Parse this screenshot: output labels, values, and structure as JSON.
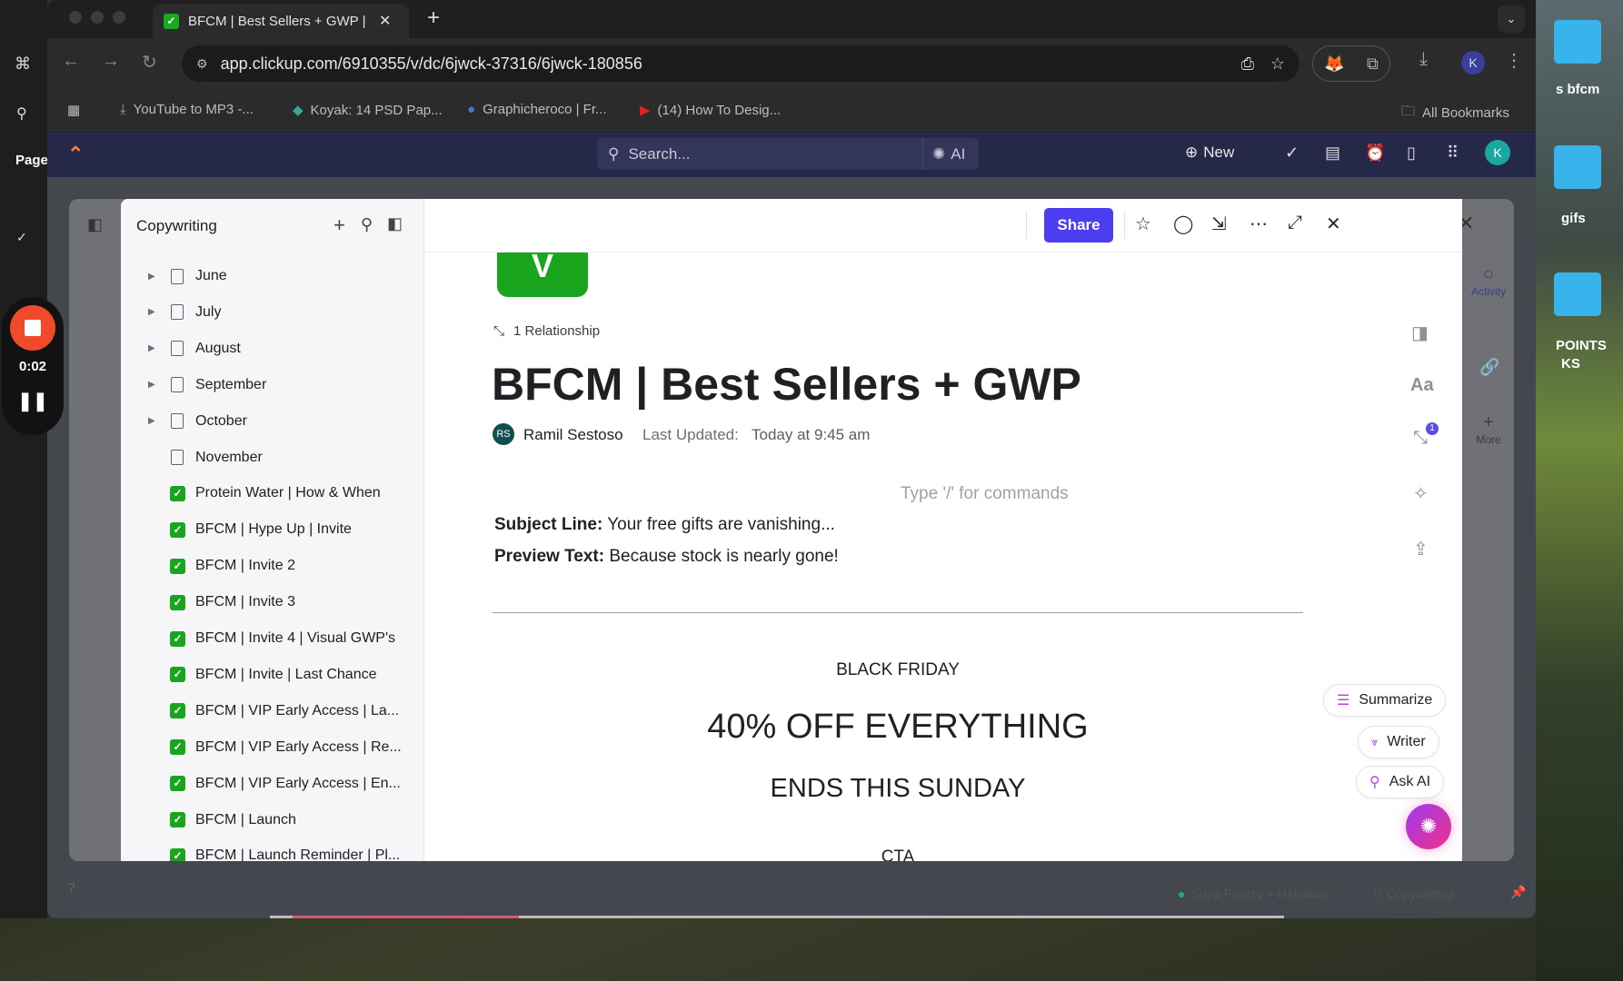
{
  "desktop": {
    "labels": [
      "s bfcm",
      "gifs",
      "POINTS",
      "KS"
    ]
  },
  "recorder": {
    "time": "0:02"
  },
  "figma_strip": {
    "page_label": "Page"
  },
  "browser": {
    "tab_title": "BFCM | Best Sellers + GWP | C",
    "url": "app.clickup.com/6910355/v/dc/6jwck-37316/6jwck-180856",
    "profile_initial": "K",
    "bookmarks": [
      "YouTube to MP3 -...",
      "Koyak: 14 PSD Pap...",
      "Graphicheroco | Fr...",
      "(14) How To Desig..."
    ],
    "all_bookmarks": "All Bookmarks"
  },
  "clickup_top": {
    "search_placeholder": "Search...",
    "ai_label": "AI",
    "new_label": "New",
    "avatar_initial": "K"
  },
  "sidebar": {
    "title": "Copywriting",
    "items": [
      {
        "label": "June",
        "type": "folder"
      },
      {
        "label": "July",
        "type": "folder"
      },
      {
        "label": "August",
        "type": "folder"
      },
      {
        "label": "September",
        "type": "folder"
      },
      {
        "label": "October",
        "type": "folder"
      },
      {
        "label": "November",
        "type": "doc"
      },
      {
        "label": "Protein Water | How & When",
        "type": "done"
      },
      {
        "label": "BFCM | Hype Up | Invite",
        "type": "done"
      },
      {
        "label": "BFCM | Invite 2",
        "type": "done"
      },
      {
        "label": "BFCM | Invite 3",
        "type": "done"
      },
      {
        "label": "BFCM | Invite 4 | Visual GWP's",
        "type": "done"
      },
      {
        "label": "BFCM | Invite | Last Chance",
        "type": "done"
      },
      {
        "label": "BFCM | VIP Early Access | La...",
        "type": "done"
      },
      {
        "label": "BFCM | VIP Early Access | Re...",
        "type": "done"
      },
      {
        "label": "BFCM | VIP Early Access | En...",
        "type": "done"
      },
      {
        "label": "BFCM | Launch",
        "type": "done"
      },
      {
        "label": "BFCM | Launch Reminder | Pl...",
        "type": "done"
      }
    ]
  },
  "doc_header": {
    "share_label": "Share"
  },
  "doc": {
    "relationship": "1 Relationship",
    "title": "BFCM | Best Sellers + GWP",
    "author_initials": "RS",
    "author": "Ramil Sestoso",
    "last_updated_label": "Last Updated:",
    "last_updated_value": "Today at 9:45 am",
    "command_placeholder": "Type '/' for commands",
    "subject_label": "Subject Line:",
    "subject_value": "Your free gifts are vanishing...",
    "preview_label": "Preview Text:",
    "preview_value": "Because stock is nearly gone!",
    "black_friday": "BLACK FRIDAY",
    "headline": "40% OFF EVERYTHING",
    "subheadline": "ENDS THIS SUNDAY",
    "cta": "CTA"
  },
  "rail": {
    "aa": "Aa",
    "relationship_badge": "1"
  },
  "right_panel": {
    "activity": "Activity",
    "more": "More"
  },
  "ai": {
    "summarize": "Summarize",
    "writer": "Writer",
    "ask": "Ask AI"
  },
  "footer": {
    "location1": "Supp Frenzy + Hallowee",
    "location2": "Copywriting"
  },
  "colors": {
    "accent": "#4b3df0",
    "topbar": "#262847",
    "done": "#1aa51f",
    "recorder": "#f04a2a",
    "ai_gradient_start": "#9b3df0",
    "ai_gradient_end": "#f0308a"
  }
}
